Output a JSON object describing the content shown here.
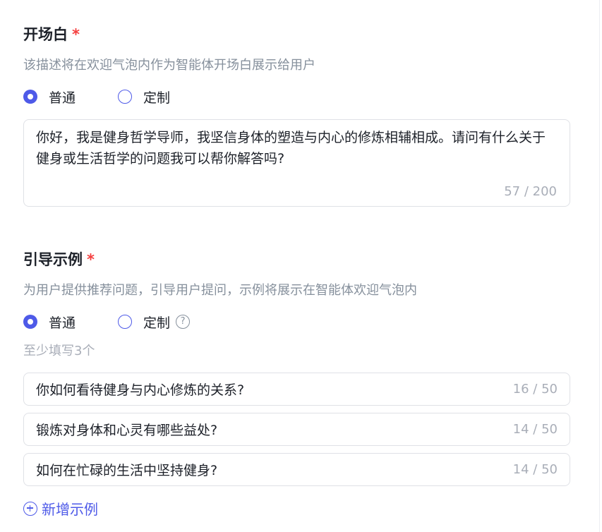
{
  "opening": {
    "title": "开场白",
    "required_mark": "*",
    "description": "该描述将在欢迎气泡内作为智能体开场白展示给用户",
    "options": [
      "普通",
      "定制"
    ],
    "selected": "普通",
    "text": "你好，我是健身哲学导师，我坚信身体的塑造与内心的修炼相辅相成。请问有什么关于健身或生活哲学的问题我可以帮你解答吗?",
    "counter": "57 / 200"
  },
  "guide": {
    "title": "引导示例",
    "required_mark": "*",
    "description": "为用户提供推荐问题，引导用户提问，示例将展示在智能体欢迎气泡内",
    "options": [
      "普通",
      "定制"
    ],
    "selected": "普通",
    "help_glyph": "?",
    "hint": "至少填写3个",
    "examples": [
      {
        "text": "你如何看待健身与内心修炼的关系?",
        "counter": "16 / 50"
      },
      {
        "text": "锻炼对身体和心灵有哪些益处?",
        "counter": "14 / 50"
      },
      {
        "text": "如何在忙碌的生活中坚持健身?",
        "counter": "14 / 50"
      }
    ],
    "add_label": "新增示例"
  },
  "colors": {
    "accent": "#4e5ae8",
    "required": "#f53f3f",
    "muted": "#86909c",
    "placeholder": "#a9aeb8",
    "border": "#dfe1e6"
  }
}
